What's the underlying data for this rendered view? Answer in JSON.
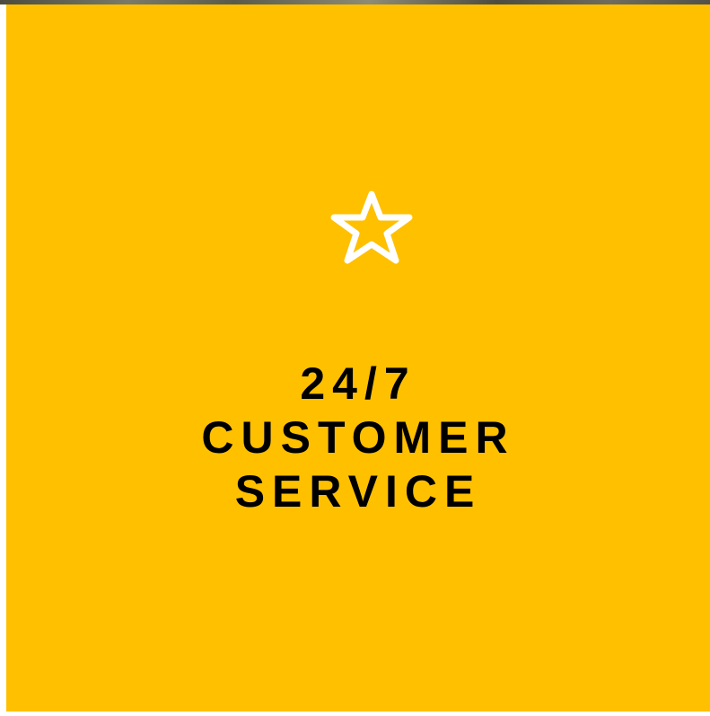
{
  "card": {
    "icon": "star-outline-icon",
    "headline_lines": [
      "24/7",
      "CUSTOMER",
      "SERVICE"
    ]
  },
  "colors": {
    "background": "#ffc000",
    "icon": "#ffffff",
    "text": "#000000"
  }
}
